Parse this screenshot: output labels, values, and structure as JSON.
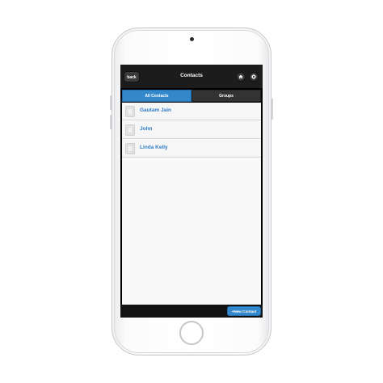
{
  "header": {
    "back_label": "back",
    "title": "Contacts",
    "home_icon": "home-icon",
    "settings_icon": "gear-icon"
  },
  "tabs": [
    {
      "label": "All Contacts",
      "active": true
    },
    {
      "label": "Groups",
      "active": false
    }
  ],
  "contacts": [
    {
      "name": "Gautam Jain"
    },
    {
      "name": "John"
    },
    {
      "name": "Linda Kelly"
    }
  ],
  "footer": {
    "new_contact_label": "+New Contact"
  },
  "colors": {
    "accent": "#3388cc",
    "link_text": "#2f7dc6",
    "header_bg": "#1c1c1c"
  }
}
